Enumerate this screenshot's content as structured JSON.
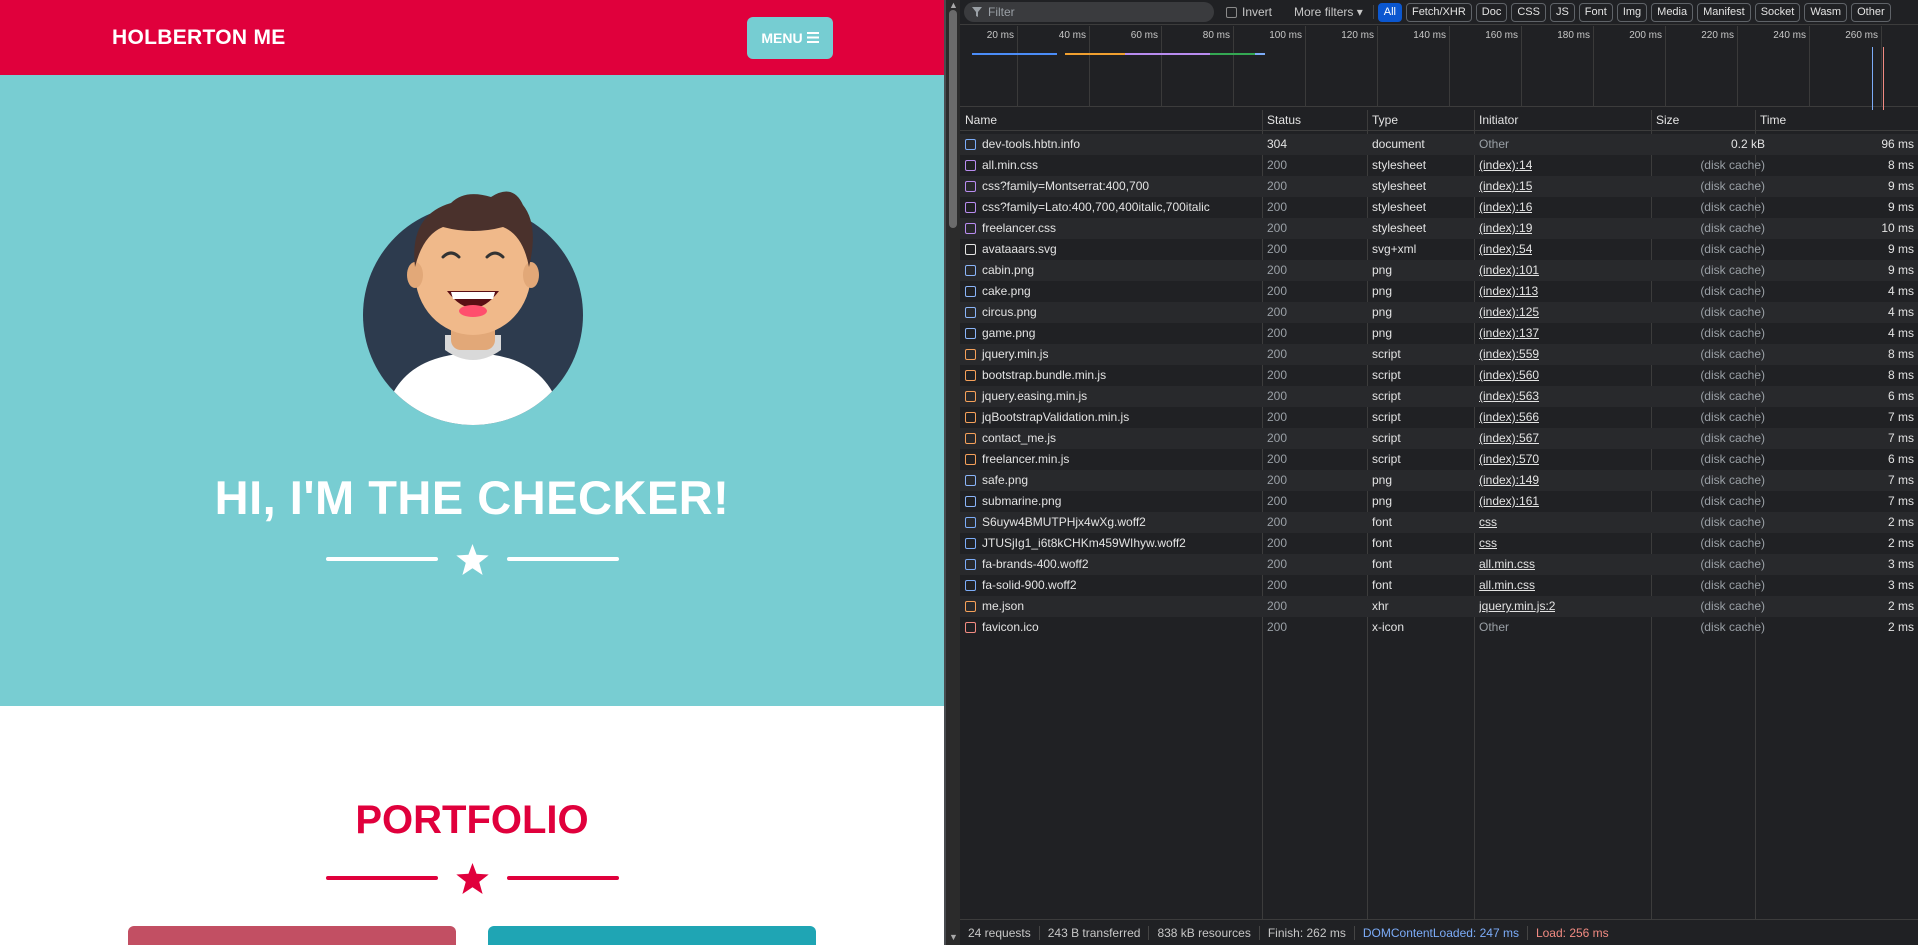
{
  "site": {
    "brand": "HOLBERTON ME",
    "menu_label": "MENU",
    "hero_title": "HI, I'M THE CHECKER!",
    "section_title": "PORTFOLIO",
    "colors": {
      "nav": "#e0003c",
      "masthead": "#78cdd2",
      "accent": "#e0003c",
      "card1": "#c24f63",
      "card2": "#1fa5b4"
    }
  },
  "devtools": {
    "filter_placeholder": "Filter",
    "invert_label": "Invert",
    "more_filters_label": "More filters",
    "type_filters": [
      "All",
      "Fetch/XHR",
      "Doc",
      "CSS",
      "JS",
      "Font",
      "Img",
      "Media",
      "Manifest",
      "Socket",
      "Wasm",
      "Other"
    ],
    "active_filter": "All",
    "timeline_ticks": [
      "20 ms",
      "40 ms",
      "60 ms",
      "80 ms",
      "100 ms",
      "120 ms",
      "140 ms",
      "160 ms",
      "180 ms",
      "200 ms",
      "220 ms",
      "240 ms",
      "260 ms"
    ],
    "columns": {
      "name": "Name",
      "status": "Status",
      "type": "Type",
      "initiator": "Initiator",
      "size": "Size",
      "time": "Time"
    },
    "requests": [
      {
        "name": "dev-tools.hbtn.info",
        "status": "304",
        "type": "document",
        "initiator": "Other",
        "size": "0.2 kB",
        "time": "96 ms",
        "icon": "document-icon"
      },
      {
        "name": "all.min.css",
        "status": "200",
        "type": "stylesheet",
        "initiator": "(index):14",
        "size": "(disk cache)",
        "time": "8 ms",
        "icon": "stylesheet-icon"
      },
      {
        "name": "css?family=Montserrat:400,700",
        "status": "200",
        "type": "stylesheet",
        "initiator": "(index):15",
        "size": "(disk cache)",
        "time": "9 ms",
        "icon": "stylesheet-icon"
      },
      {
        "name": "css?family=Lato:400,700,400italic,700italic",
        "status": "200",
        "type": "stylesheet",
        "initiator": "(index):16",
        "size": "(disk cache)",
        "time": "9 ms",
        "icon": "stylesheet-icon"
      },
      {
        "name": "freelancer.css",
        "status": "200",
        "type": "stylesheet",
        "initiator": "(index):19",
        "size": "(disk cache)",
        "time": "10 ms",
        "icon": "stylesheet-icon"
      },
      {
        "name": "avataaars.svg",
        "status": "200",
        "type": "svg+xml",
        "initiator": "(index):54",
        "size": "(disk cache)",
        "time": "9 ms",
        "icon": "avatar-image-icon"
      },
      {
        "name": "cabin.png",
        "status": "200",
        "type": "png",
        "initiator": "(index):101",
        "size": "(disk cache)",
        "time": "9 ms",
        "icon": "image-icon"
      },
      {
        "name": "cake.png",
        "status": "200",
        "type": "png",
        "initiator": "(index):113",
        "size": "(disk cache)",
        "time": "4 ms",
        "icon": "image-icon"
      },
      {
        "name": "circus.png",
        "status": "200",
        "type": "png",
        "initiator": "(index):125",
        "size": "(disk cache)",
        "time": "4 ms",
        "icon": "image-icon"
      },
      {
        "name": "game.png",
        "status": "200",
        "type": "png",
        "initiator": "(index):137",
        "size": "(disk cache)",
        "time": "4 ms",
        "icon": "image-icon"
      },
      {
        "name": "jquery.min.js",
        "status": "200",
        "type": "script",
        "initiator": "(index):559",
        "size": "(disk cache)",
        "time": "8 ms",
        "icon": "script-icon"
      },
      {
        "name": "bootstrap.bundle.min.js",
        "status": "200",
        "type": "script",
        "initiator": "(index):560",
        "size": "(disk cache)",
        "time": "8 ms",
        "icon": "script-icon"
      },
      {
        "name": "jquery.easing.min.js",
        "status": "200",
        "type": "script",
        "initiator": "(index):563",
        "size": "(disk cache)",
        "time": "6 ms",
        "icon": "script-icon"
      },
      {
        "name": "jqBootstrapValidation.min.js",
        "status": "200",
        "type": "script",
        "initiator": "(index):566",
        "size": "(disk cache)",
        "time": "7 ms",
        "icon": "script-icon"
      },
      {
        "name": "contact_me.js",
        "status": "200",
        "type": "script",
        "initiator": "(index):567",
        "size": "(disk cache)",
        "time": "7 ms",
        "icon": "script-icon"
      },
      {
        "name": "freelancer.min.js",
        "status": "200",
        "type": "script",
        "initiator": "(index):570",
        "size": "(disk cache)",
        "time": "6 ms",
        "icon": "script-icon"
      },
      {
        "name": "safe.png",
        "status": "200",
        "type": "png",
        "initiator": "(index):149",
        "size": "(disk cache)",
        "time": "7 ms",
        "icon": "image-icon"
      },
      {
        "name": "submarine.png",
        "status": "200",
        "type": "png",
        "initiator": "(index):161",
        "size": "(disk cache)",
        "time": "7 ms",
        "icon": "image-icon"
      },
      {
        "name": "S6uyw4BMUTPHjx4wXg.woff2",
        "status": "200",
        "type": "font",
        "initiator": "css",
        "size": "(disk cache)",
        "time": "2 ms",
        "icon": "font-icon"
      },
      {
        "name": "JTUSjIg1_i6t8kCHKm459WIhyw.woff2",
        "status": "200",
        "type": "font",
        "initiator": "css",
        "size": "(disk cache)",
        "time": "2 ms",
        "icon": "font-icon"
      },
      {
        "name": "fa-brands-400.woff2",
        "status": "200",
        "type": "font",
        "initiator": "all.min.css",
        "size": "(disk cache)",
        "time": "3 ms",
        "icon": "font-icon"
      },
      {
        "name": "fa-solid-900.woff2",
        "status": "200",
        "type": "font",
        "initiator": "all.min.css",
        "size": "(disk cache)",
        "time": "3 ms",
        "icon": "font-icon"
      },
      {
        "name": "me.json",
        "status": "200",
        "type": "xhr",
        "initiator": "jquery.min.js:2",
        "size": "(disk cache)",
        "time": "2 ms",
        "icon": "xhr-icon"
      },
      {
        "name": "favicon.ico",
        "status": "200",
        "type": "x-icon",
        "initiator": "Other",
        "size": "(disk cache)",
        "time": "2 ms",
        "icon": "favicon-icon"
      }
    ],
    "summary": {
      "requests": "24 requests",
      "transferred": "243 B transferred",
      "resources": "838 kB resources",
      "finish": "Finish: 262 ms",
      "dom_content_loaded": "DOMContentLoaded: 247 ms",
      "load": "Load: 256 ms"
    }
  }
}
